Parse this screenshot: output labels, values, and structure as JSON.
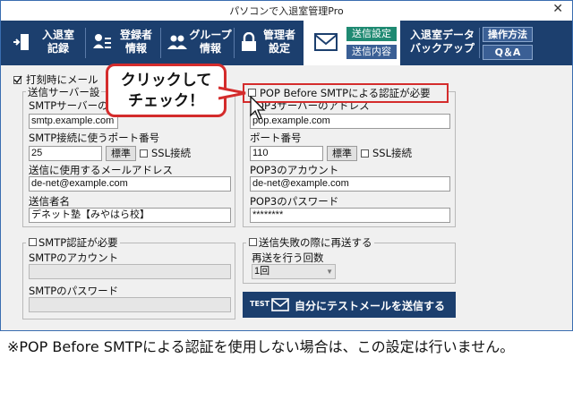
{
  "window": {
    "title": "パソコンで入退室管理Pro",
    "close": "✕"
  },
  "toolbar": {
    "entry_record": [
      "入退室",
      "記録"
    ],
    "register_info": [
      "登録者",
      "情報"
    ],
    "group_info": [
      "グループ",
      "情報"
    ],
    "admin_settings": [
      "管理者",
      "設定"
    ],
    "send_settings": "送信設定",
    "send_content": "送信内容",
    "backup": [
      "入退室データ",
      "バックアップ"
    ],
    "howto": "操作方法",
    "qa": "Q＆A"
  },
  "form": {
    "print_option_label": "打刻時にメール",
    "send_server_group": "送信サーバー設",
    "smtp_server_label": "SMTPサーバーの",
    "smtp_server_value": "smtp.example.com",
    "smtp_port_label": "SMTP接続に使うポート番号",
    "smtp_port_value": "25",
    "standard_label": "標準",
    "ssl_label": "SSL接続",
    "send_address_label": "送信に使用するメールアドレス",
    "send_address_value": "de-net@example.com",
    "sender_name_label": "送信者名",
    "sender_name_value": "デネット塾【みやはら校】",
    "pop_before_label": "POP Before SMTPによる認証が必要",
    "pop_server_label": "POP3サーバーのアドレス",
    "pop_server_value": "pop.example.com",
    "pop_port_label": "ポート番号",
    "pop_port_value": "110",
    "pop_standard_label": "標準",
    "pop_ssl_label": "SSL接続",
    "pop_account_label": "POP3のアカウント",
    "pop_account_value": "de-net@example.com",
    "pop_password_label": "POP3のパスワード",
    "pop_password_value": "********",
    "smtp_auth_label": "SMTP認証が必要",
    "smtp_account_label": "SMTPのアカウント",
    "smtp_password_label": "SMTPのパスワード",
    "retry_label": "送信失敗の際に再送する",
    "retry_count_label": "再送を行う回数",
    "retry_count_value": "1回",
    "test_prefix": "TEST",
    "test_button_label": "自分にテストメールを送信する"
  },
  "callout": {
    "line1": "クリックして",
    "line2": "チェック！"
  },
  "note": "※POP Before SMTPによる認証を使用しない場合は、この設定は行いません。",
  "colors": {
    "toolbar": "#1c3f6e",
    "accent_green": "#1f8a72",
    "highlight_red": "#d42c2c"
  }
}
